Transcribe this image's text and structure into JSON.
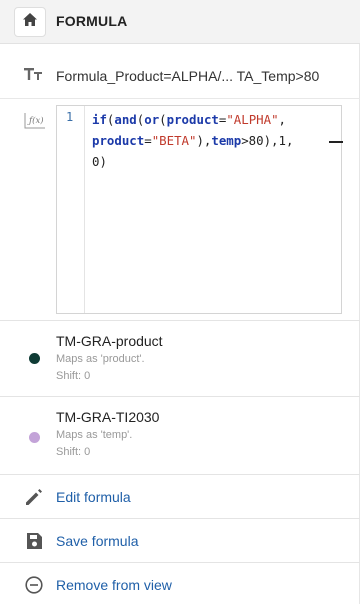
{
  "header": {
    "title": "FORMULA",
    "home_icon": "home-icon"
  },
  "formula": {
    "name": "Formula_Product=ALPHA/... TA_Temp>80",
    "name_icon": "text-type-icon",
    "fx_icon": "function-icon",
    "line_number": "1",
    "code": "if(and(or(product=\"ALPHA\", product=\"BETA\"),temp>80),1, 0)"
  },
  "series": [
    {
      "title": "TM-GRA-product",
      "maps": "Maps as 'product'.",
      "shift": "Shift: 0",
      "color": "#0f3b35"
    },
    {
      "title": "TM-GRA-TI2030",
      "maps": "Maps as 'temp'.",
      "shift": "Shift: 0",
      "color": "#c3a3d8"
    }
  ],
  "actions": {
    "edit": {
      "label": "Edit formula",
      "icon": "pencil-icon"
    },
    "save": {
      "label": "Save formula",
      "icon": "floppy-disk-icon"
    },
    "remove": {
      "label": "Remove from view",
      "icon": "minus-circle-icon"
    }
  },
  "colors": {
    "link": "#1f5fa8",
    "header_bg": "#f3f3f3"
  }
}
